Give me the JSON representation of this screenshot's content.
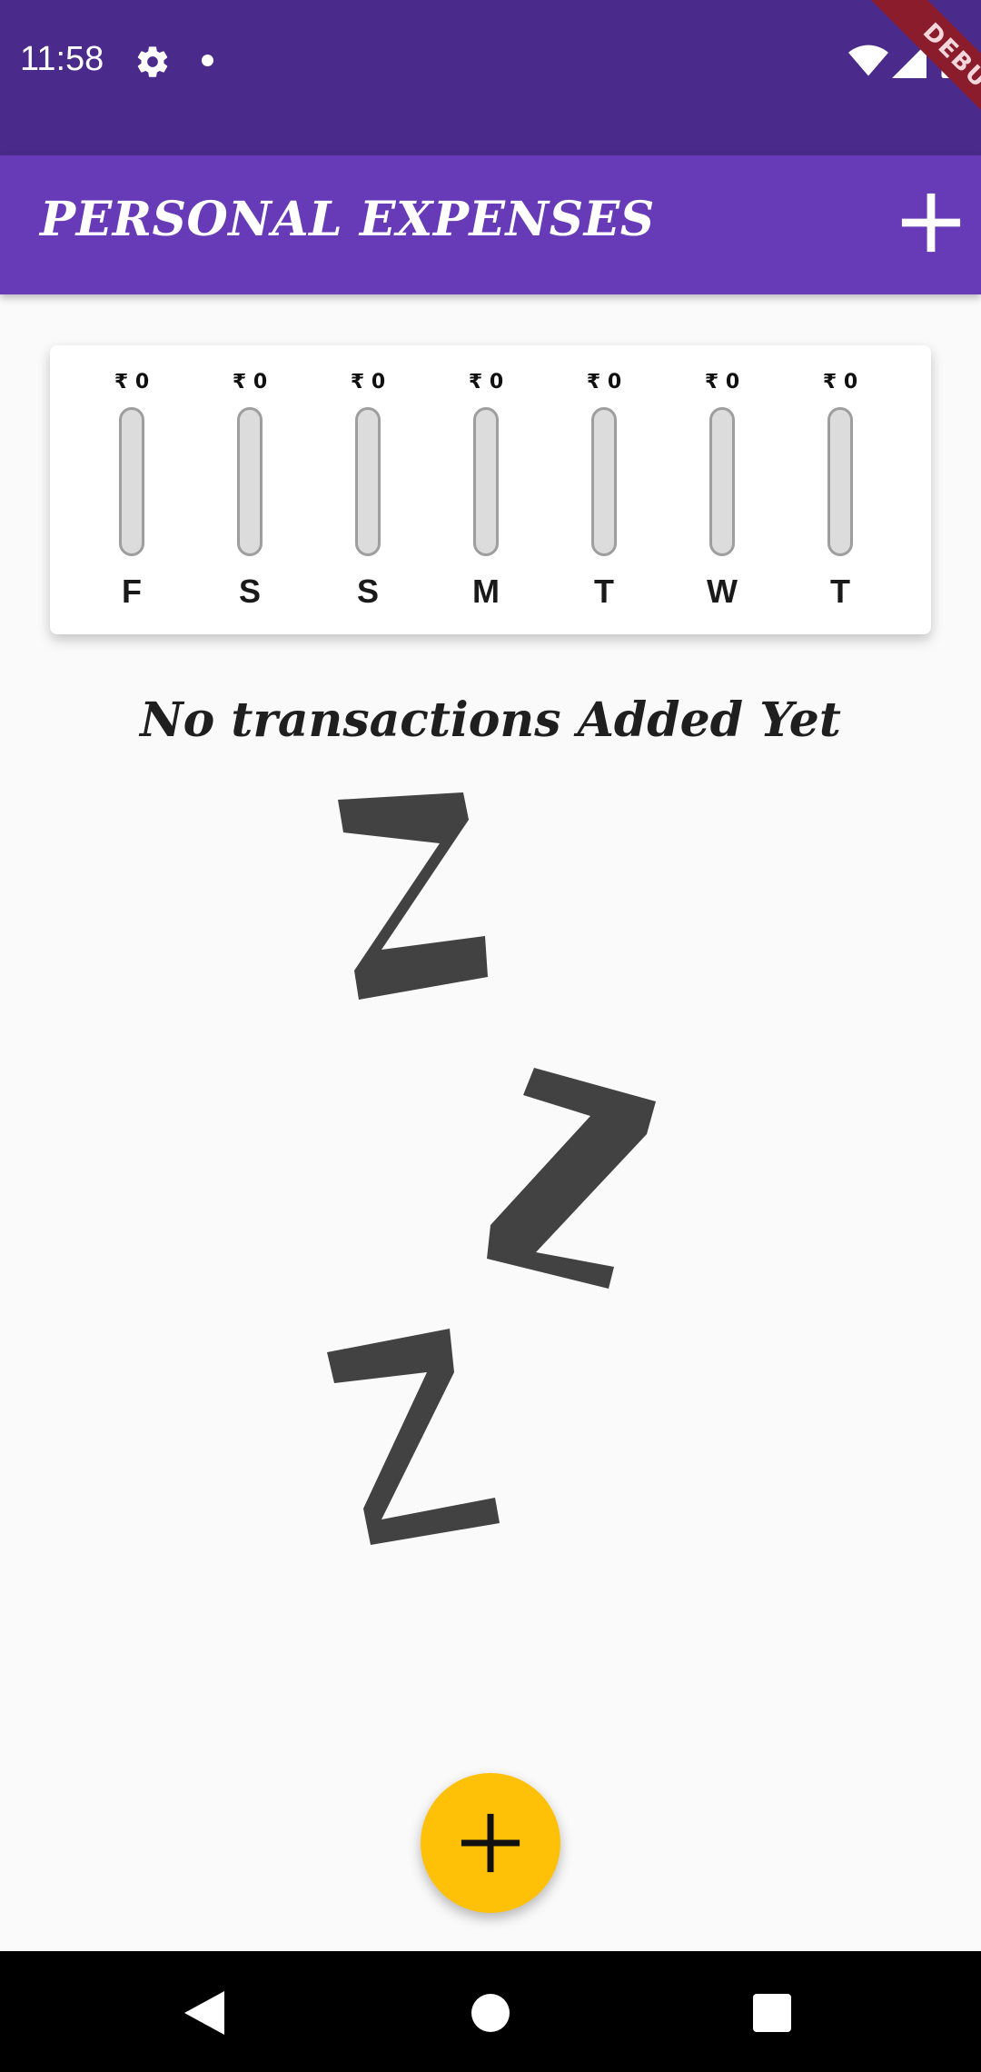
{
  "status_bar": {
    "time": "11:58",
    "icons": [
      "gear-icon",
      "notification-dot-icon",
      "wifi-icon",
      "signal-icon",
      "battery-icon"
    ],
    "debug_label": "DEBUG"
  },
  "app_bar": {
    "title": "PERSONAL EXPENSES",
    "add_icon": "plus-icon"
  },
  "chart": {
    "bars": [
      {
        "day": "F",
        "amount": "₹ 0",
        "fraction": 0
      },
      {
        "day": "S",
        "amount": "₹ 0",
        "fraction": 0
      },
      {
        "day": "S",
        "amount": "₹ 0",
        "fraction": 0
      },
      {
        "day": "M",
        "amount": "₹ 0",
        "fraction": 0
      },
      {
        "day": "T",
        "amount": "₹ 0",
        "fraction": 0
      },
      {
        "day": "W",
        "amount": "₹ 0",
        "fraction": 0
      },
      {
        "day": "T",
        "amount": "₹ 0",
        "fraction": 0
      }
    ]
  },
  "empty_state": {
    "message": "No transactions Added Yet",
    "image": "zzz-sleep-icon"
  },
  "fab": {
    "icon": "plus-icon"
  },
  "nav_bar": {
    "icons": [
      "back-icon",
      "home-icon",
      "recents-icon"
    ]
  },
  "colors": {
    "status_bar": "#4a2a8a",
    "primary": "#673ab7",
    "accent": "#ffc107",
    "background": "#fafafa"
  }
}
